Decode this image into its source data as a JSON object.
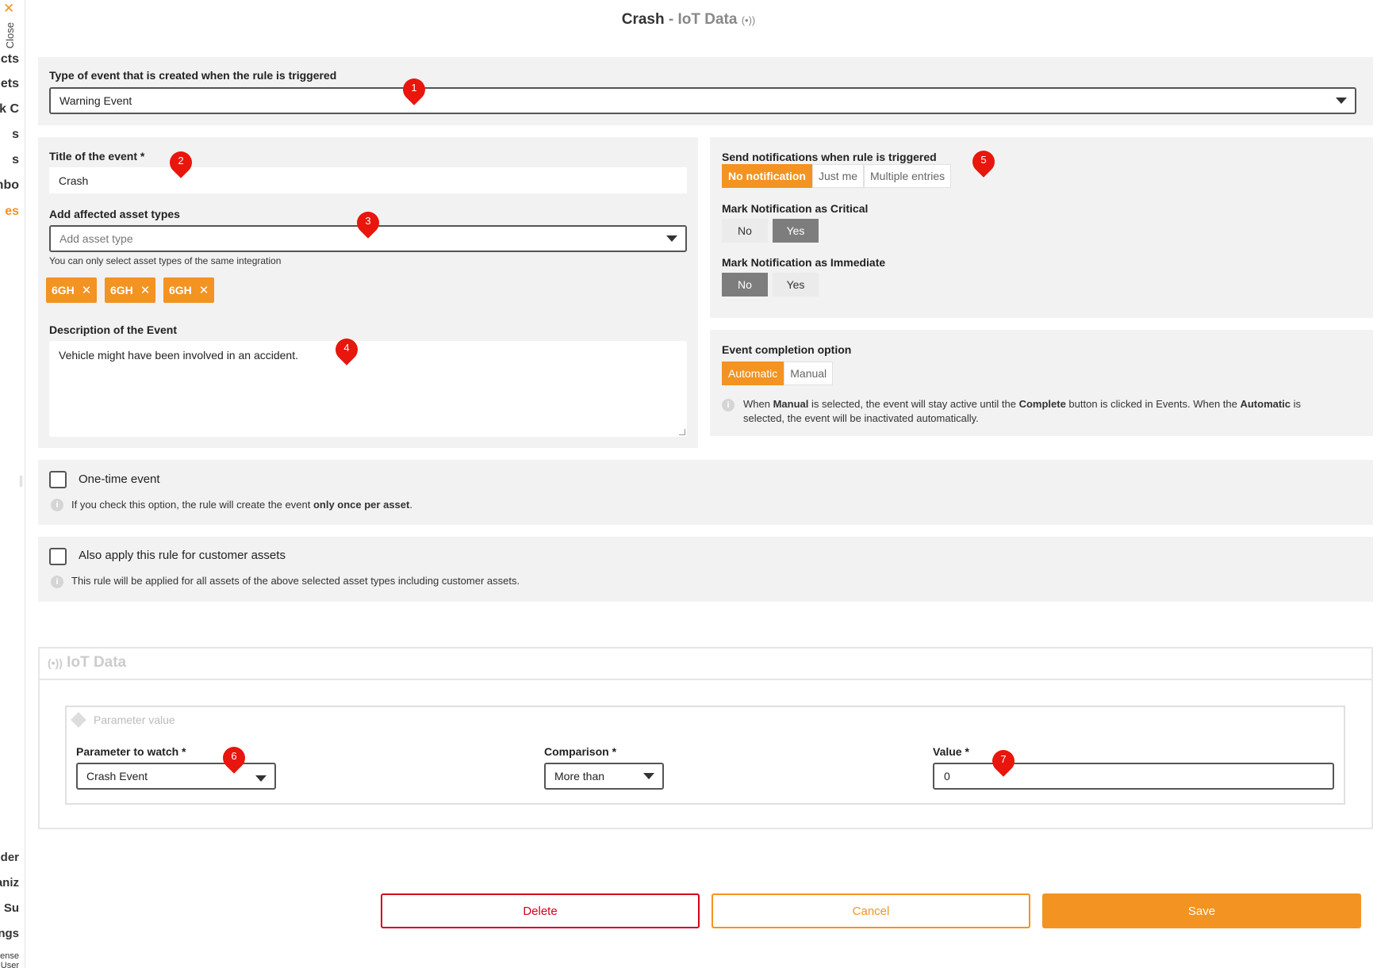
{
  "sidebar": {
    "close_label": "Close",
    "items": [
      "cts",
      "ets",
      "k C",
      "s",
      "s",
      "hbo",
      "es"
    ],
    "bottom_items": [
      "der",
      "aniz",
      "d Su",
      "ngs"
    ],
    "footer_line1": "ense",
    "footer_line2": "User"
  },
  "header": {
    "title": "Crash",
    "separator": " - ",
    "subtitle": "IoT Data",
    "icon": "broadcast-icon"
  },
  "event_type": {
    "label": "Type of event that is created when the rule is triggered",
    "value": "Warning Event"
  },
  "event_title": {
    "label": "Title of the event *",
    "value": "Crash"
  },
  "asset_types": {
    "label": "Add affected asset types",
    "placeholder": "Add asset type",
    "hint": "You can only select asset types of the same integration",
    "tags": [
      "6GH",
      "6GH",
      "6GH"
    ]
  },
  "description": {
    "label": "Description of the Event",
    "value": "Vehicle might have been involved in an accident."
  },
  "notifications": {
    "label": "Send notifications when rule is triggered",
    "options": [
      "No notification",
      "Just me",
      "Multiple entries"
    ],
    "selected": "No notification"
  },
  "critical": {
    "label": "Mark Notification as Critical",
    "options": [
      "No",
      "Yes"
    ],
    "selected": "Yes"
  },
  "immediate": {
    "label": "Mark Notification as Immediate",
    "options": [
      "No",
      "Yes"
    ],
    "selected": "No"
  },
  "completion": {
    "label": "Event completion option",
    "options": [
      "Automatic",
      "Manual"
    ],
    "selected": "Automatic",
    "info_parts": [
      "When ",
      "Manual",
      " is selected, the event will stay active until the ",
      "Complete",
      " button is clicked in Events. When the ",
      "Automatic",
      " is selected, the event will be inactivated automatically."
    ]
  },
  "one_time": {
    "label": "One-time event",
    "info_before": "If you check this option, the rule will create the event ",
    "info_bold": "only once per asset",
    "info_after": ".",
    "checked": false
  },
  "customer_assets": {
    "label": "Also apply this rule for customer assets",
    "info": "This rule will be applied for all assets of the above selected asset types including customer assets.",
    "checked": false
  },
  "iot": {
    "title": "IoT Data",
    "section_label": "Parameter value",
    "parameter": {
      "label": "Parameter to watch *",
      "value": "Crash Event"
    },
    "comparison": {
      "label": "Comparison *",
      "value": "More than"
    },
    "value": {
      "label": "Value *",
      "value": "0"
    }
  },
  "buttons": {
    "delete": "Delete",
    "cancel": "Cancel",
    "save": "Save"
  },
  "annotations": [
    "1",
    "2",
    "3",
    "4",
    "5",
    "6",
    "7"
  ],
  "colors": {
    "accent": "#f39321",
    "danger": "#d0021b",
    "marker": "#e8160c",
    "panel": "#f2f2f2",
    "toggle_on": "#7d7d7d"
  }
}
